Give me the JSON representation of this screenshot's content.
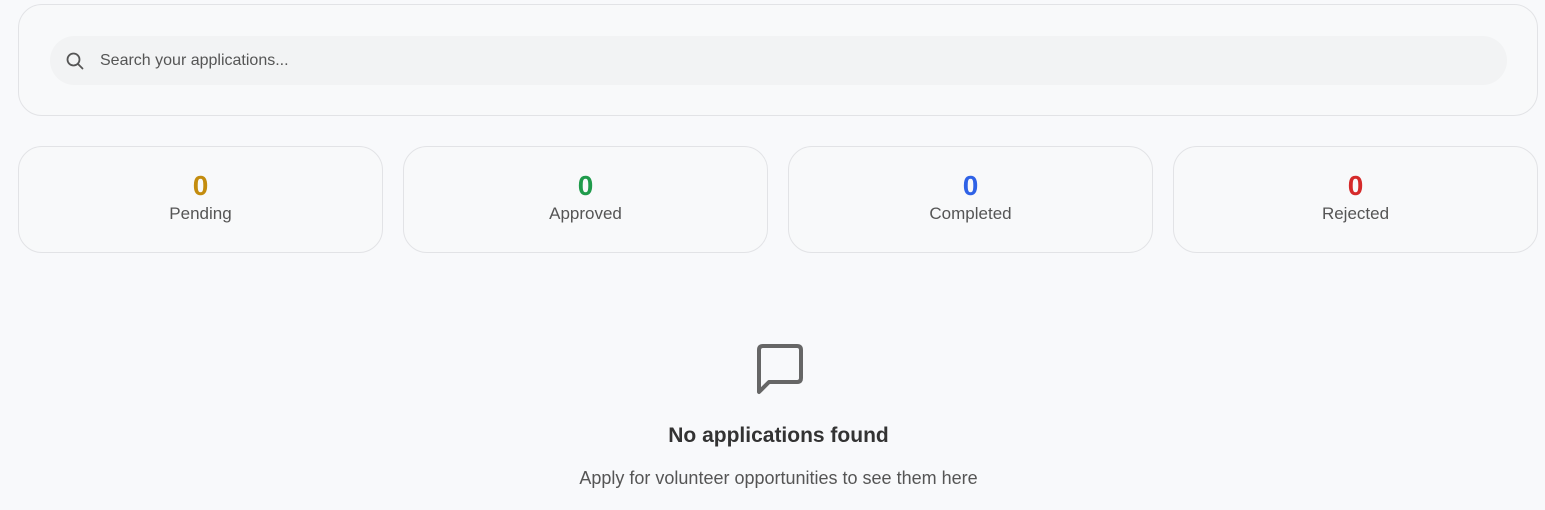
{
  "search": {
    "placeholder": "Search your applications...",
    "icon": "search-icon"
  },
  "stats": [
    {
      "value": "0",
      "label": "Pending",
      "color": "#c38c0e"
    },
    {
      "value": "0",
      "label": "Approved",
      "color": "#1f9b4b"
    },
    {
      "value": "0",
      "label": "Completed",
      "color": "#2f62e6"
    },
    {
      "value": "0",
      "label": "Rejected",
      "color": "#d52a2a"
    }
  ],
  "empty_state": {
    "icon": "chat-bubble-icon",
    "title": "No applications found",
    "subtitle": "Apply for volunteer opportunities to see them here"
  }
}
